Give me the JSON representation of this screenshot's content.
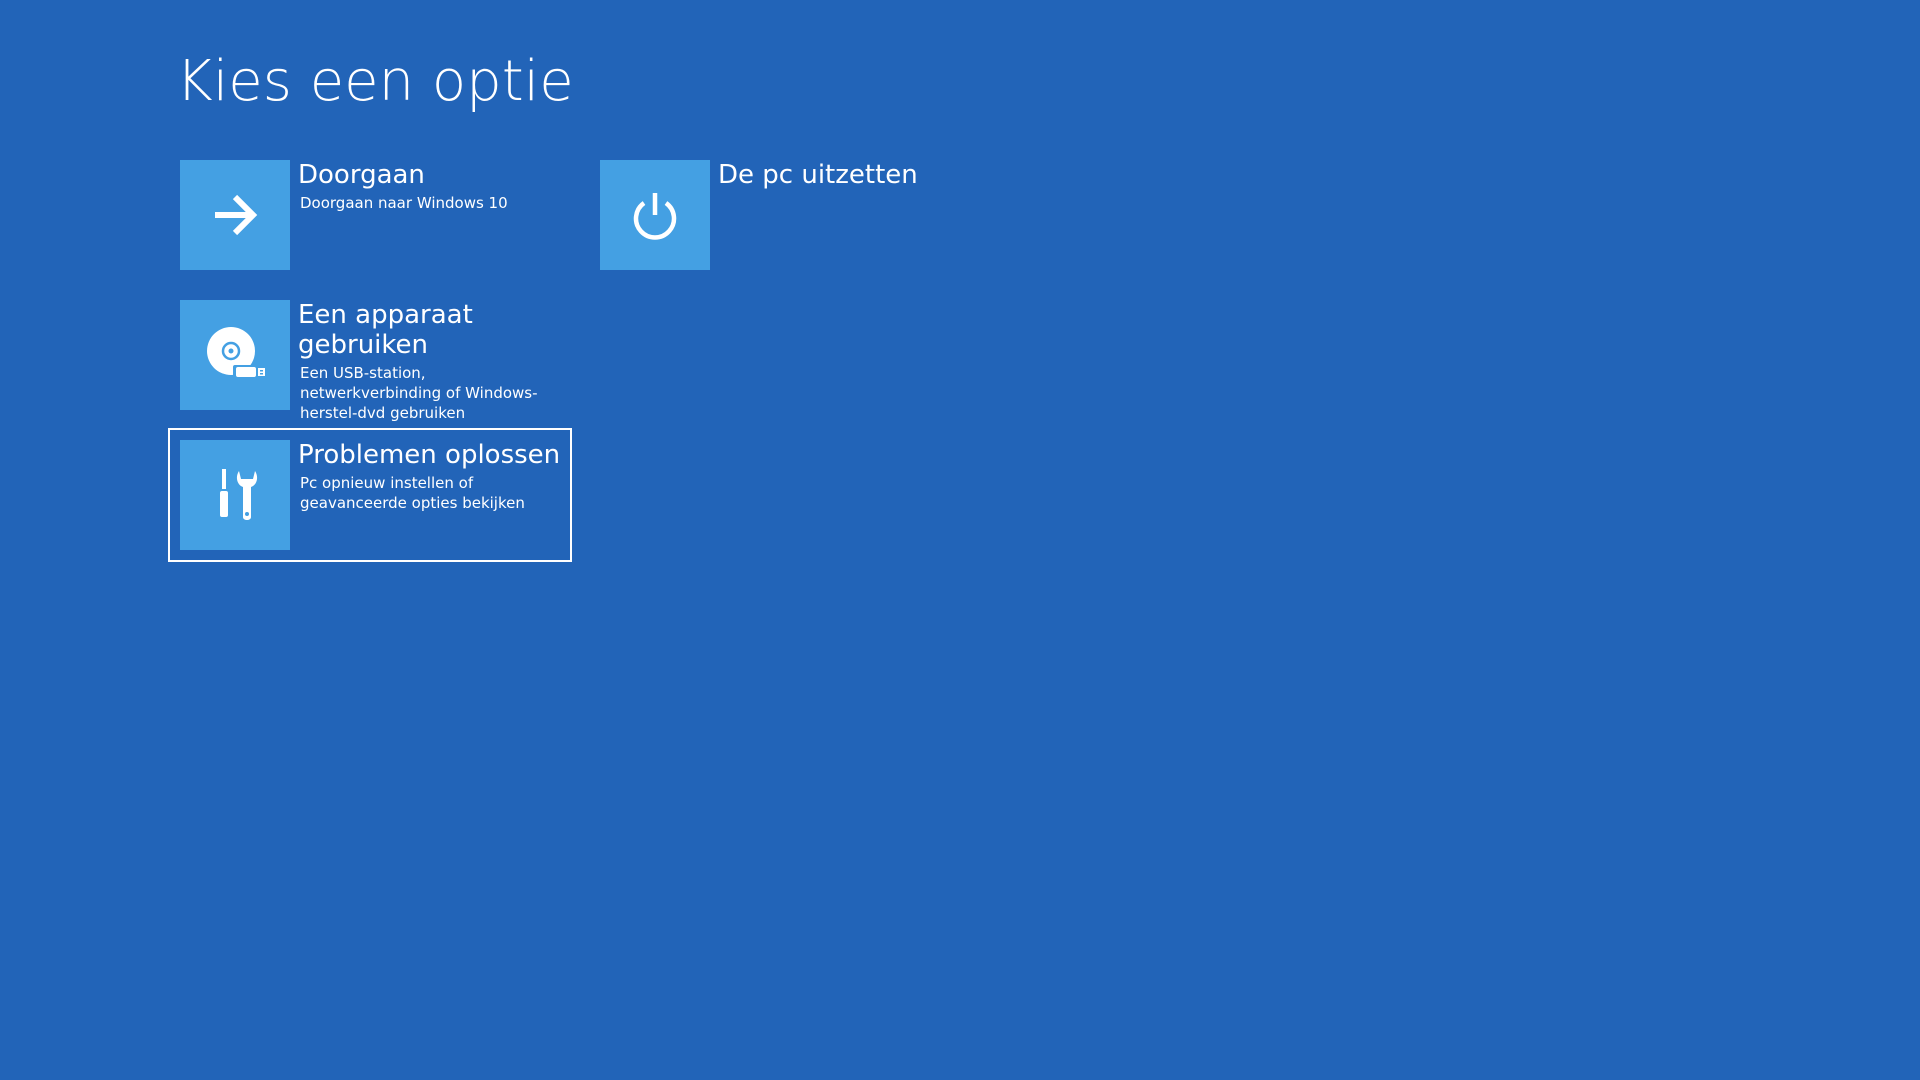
{
  "page": {
    "title": "Kies een optie",
    "background_color": "#2264b8",
    "tile_color": "#44a0e3"
  },
  "options": [
    {
      "id": "continue",
      "title": "Doorgaan",
      "description": "Doorgaan naar Windows 10",
      "icon": "arrow-right-icon"
    },
    {
      "id": "use-device",
      "title": "Een apparaat gebruiken",
      "description": "Een USB-station, netwerkverbinding of Windows-herstel-dvd gebruiken",
      "icon": "disc-usb-icon"
    },
    {
      "id": "troubleshoot",
      "title": "Problemen oplossen",
      "description": "Pc opnieuw instellen of geavanceerde opties bekijken",
      "icon": "tools-icon",
      "selected": true
    },
    {
      "id": "shutdown",
      "title": "De pc uitzetten",
      "description": "",
      "icon": "power-icon"
    }
  ]
}
